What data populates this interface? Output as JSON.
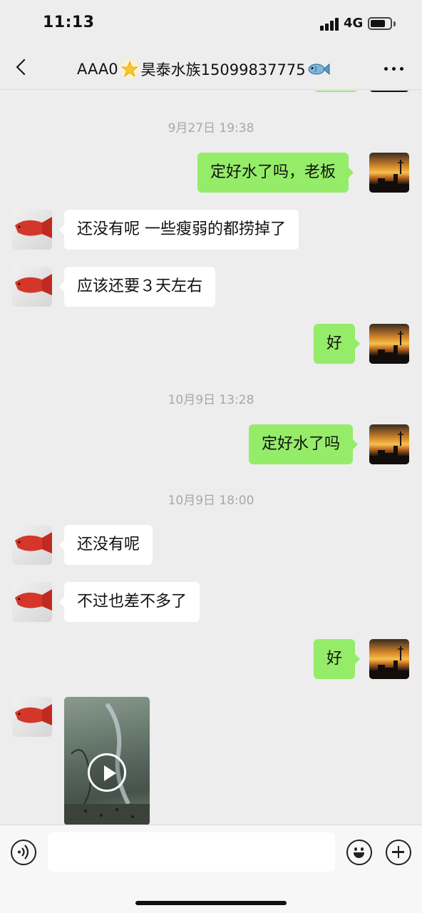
{
  "status_bar": {
    "time": "11:13",
    "network": "4G",
    "icons": [
      "signal-icon",
      "battery-icon"
    ]
  },
  "nav": {
    "back_icon": "chevron-left-icon",
    "title_prefix": "AAA0",
    "title_main": "昊泰水族15099837775",
    "title_emoji": [
      "star-icon",
      "fish-icon"
    ],
    "more_icon": "more-dots-icon"
  },
  "messages": [
    {
      "type": "timestamp",
      "text": "9月27日 19:38"
    },
    {
      "type": "outgoing",
      "text": "定好水了吗，老板"
    },
    {
      "type": "incoming",
      "text": "还没有呢 一些瘦弱的都捞掉了"
    },
    {
      "type": "incoming",
      "text": "应该还要３天左右"
    },
    {
      "type": "outgoing",
      "text": "好"
    },
    {
      "type": "timestamp",
      "text": "10月9日 13:28"
    },
    {
      "type": "outgoing",
      "text": "定好水了吗"
    },
    {
      "type": "timestamp",
      "text": "10月9日 18:00"
    },
    {
      "type": "incoming",
      "text": "还没有呢"
    },
    {
      "type": "incoming",
      "text": "不过也差不多了"
    },
    {
      "type": "outgoing",
      "text": "好"
    },
    {
      "type": "incoming-video",
      "icon": "play-icon"
    }
  ],
  "input_bar": {
    "placeholder": "",
    "icons": [
      "voice-icon",
      "emoji-icon",
      "plus-icon"
    ]
  },
  "colors": {
    "background": "#ededed",
    "outgoing_bubble": "#95ec69",
    "incoming_bubble": "#ffffff",
    "timestamp": "#a8a8a8"
  }
}
